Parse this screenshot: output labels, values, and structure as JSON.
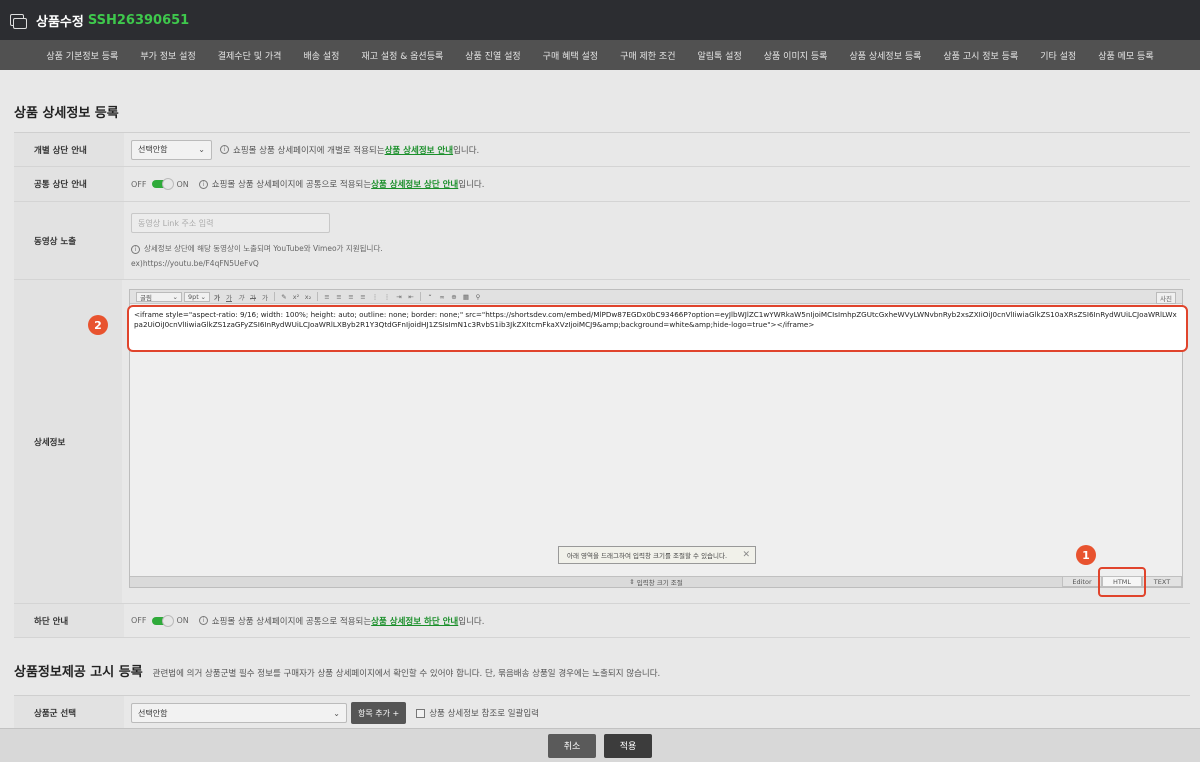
{
  "header": {
    "title": "상품수정",
    "product_code": "SSH26390651"
  },
  "nav": {
    "items": [
      "상품 기본정보 등록",
      "부가 정보 설정",
      "결제수단 및 가격",
      "배송 설정",
      "재고 설정 & 옵션등록",
      "상품 진열 설정",
      "구매 혜택 설정",
      "구매 제한 조건",
      "알림톡 설정",
      "상품 이미지 등록",
      "상품 상세정보 등록",
      "상품 고시 정보 등록",
      "기타 설정",
      "상품 메모 등록"
    ]
  },
  "detail_section": {
    "title": "상품 상세정보 등록",
    "individual_top": {
      "label": "개별 상단 안내",
      "select_value": "선택안함",
      "desc_prefix": "쇼핑몰 상품 상세페이지에 개별로 적용되는 ",
      "desc_link": "상품 상세정보 안내",
      "desc_suffix": "입니다."
    },
    "common_top": {
      "label": "공통 상단 안내",
      "off": "OFF",
      "on": "ON",
      "desc_prefix": "쇼핑몰 상품 상세페이지에 공통으로 적용되는 ",
      "desc_link": "상품 상세정보 상단 안내",
      "desc_suffix": "입니다."
    },
    "video": {
      "label": "동영상 노출",
      "placeholder": "동영상 Link 주소 입력",
      "help": "상세정보 상단에 해당 동영상이 노출되며 YouTube와 Vimeo가 지원됩니다.",
      "example": "ex)https://youtu.be/F4qFN5UeFvQ"
    },
    "detail": {
      "label": "상세정보",
      "toolbar_font": "굴림",
      "toolbar_size": "9pt",
      "toolbar_right": "사진",
      "code": "<iframe style=\"aspect-ratio: 9/16; width: 100%; height: auto; outline: none; border: none;\" src=\"https://shortsdev.com/embed/MlPDw87EGDx0bC93466P?option=eyJlbWJlZC1wYWRkaW5nIjoiMCIsImhpZGUtcGxheWVyLWNvbnRyb2xsZXIiOiJ0cnVlIiwiaGlkZS10aXRsZSI6InRydWUiLCJoaWRlLWxpa2UiOiJ0cnVlIiwiaGlkZS1zaGFyZSI6InRydWUiLCJoaWRlLXByb2R1Y3QtdGFnIjoidHJ1ZSIsImN1c3RvbS1ib3JkZXItcmFkaXVzIjoiMCJ9&amp;background=white&amp;hide-logo=true\"></iframe>",
      "resize_hint": "아래 영역을 드래그하여 입력창 크기를 조절할 수 있습니다.",
      "resize_bar": "입력창 크기 조절",
      "mode_editor": "Editor",
      "mode_html": "HTML",
      "mode_text": "TEXT",
      "badge_1": "1",
      "badge_2": "2"
    },
    "bottom": {
      "label": "하단 안내",
      "off": "OFF",
      "on": "ON",
      "desc_prefix": "쇼핑몰 상품 상세페이지에 공통으로 적용되는 ",
      "desc_link": "상품 상세정보 하단 안내",
      "desc_suffix": "입니다."
    }
  },
  "notice_section": {
    "title": "상품정보제공 고시 등록",
    "desc": "관련법에 의거 상품군별 필수 정보를 구매자가 상품 상세페이지에서 확인할 수 있어야 합니다. 단, 묶음배송 상품일 경우에는 노출되지 않습니다.",
    "group": {
      "label": "상품군 선택",
      "select_value": "선택안함",
      "add_button": "항목 추가 +",
      "checkbox_label": "상품 상세정보 참조로 일괄입력"
    }
  },
  "footer": {
    "cancel": "취소",
    "apply": "적용"
  }
}
